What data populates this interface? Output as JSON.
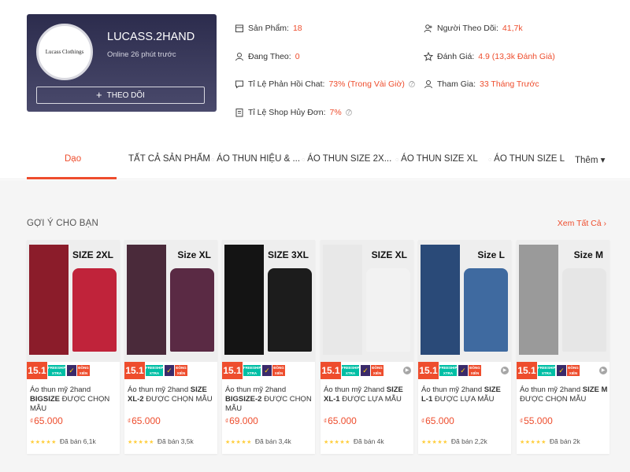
{
  "shop": {
    "avatar_text": "Lucass Clothings",
    "name": "LUCASS.2HAND",
    "online": "Online 26 phút trước",
    "follow_label": "THEO DÕI"
  },
  "stats": {
    "products_label": "Sản Phẩm:",
    "products_value": "18",
    "following_label": "Đang Theo:",
    "following_value": "0",
    "chat_label": "Tỉ Lệ Phản Hồi Chat:",
    "chat_value": "73% (Trong Vài Giờ)",
    "cancel_label": "Tỉ Lệ Shop Hủy Đơn:",
    "cancel_value": "7%",
    "followers_label": "Người Theo Dõi:",
    "followers_value": "41,7k",
    "rating_label": "Đánh Giá:",
    "rating_value": "4.9 (13,3k Đánh Giá)",
    "joined_label": "Tham Gia:",
    "joined_value": "33 Tháng Trước"
  },
  "tabs": [
    "Dạo",
    "TẤT CẢ SẢN PHẨM",
    "ÁO THUN HIỆU & ...",
    "ÁO THUN SIZE 2X...",
    "ÁO THUN SIZE XL",
    "ÁO THUN SIZE L",
    "Thêm ▾"
  ],
  "section": {
    "title": "GỢI Ý CHO BẠN",
    "see_all": "Xem Tất Cả ›"
  },
  "promo": {
    "badge": "15.1",
    "freeship": "FREESHIP XTRA",
    "dong": "ĐỒNG XIÊN"
  },
  "products": [
    {
      "size": "SIZE 2XL",
      "title_pre": "Áo thun mỹ 2hand ",
      "title_bold": "BIGSIZE",
      "title_post": " ĐƯỢC CHỌN MẪU",
      "price": "65.000",
      "sold": "Đã bán 6,1k",
      "left_color": "#8b1c2a",
      "right_color": "#c0233a"
    },
    {
      "size": "Size XL",
      "title_pre": "Áo thun mỹ 2hand ",
      "title_bold": "SIZE XL-2",
      "title_post": " ĐƯỢC CHỌN MẪU",
      "price": "65.000",
      "sold": "Đã bán 3,5k",
      "left_color": "#4a2a3a",
      "right_color": "#5a2a44"
    },
    {
      "size": "SIZE 3XL",
      "title_pre": "Áo thun mỹ 2hand ",
      "title_bold": "BIGSIZE-2",
      "title_post": " ĐƯỢC CHỌN MẪU",
      "price": "69.000",
      "sold": "Đã bán 3,4k",
      "left_color": "#141414",
      "right_color": "#1c1c1c"
    },
    {
      "size": "SIZE XL",
      "title_pre": "Áo thun mỹ 2hand ",
      "title_bold": "SIZE XL-1",
      "title_post": " ĐƯỢC LỰA MẪU",
      "price": "65.000",
      "sold": "Đã bán 4k",
      "left_color": "#e8e8e8",
      "right_color": "#f2f2f2"
    },
    {
      "size": "Size L",
      "title_pre": "Áo thun mỹ 2hand ",
      "title_bold": "SIZE L-1",
      "title_post": " ĐƯỢC LỰA MẪU",
      "price": "65.000",
      "sold": "Đã bán 2,2k",
      "left_color": "#2a4a78",
      "right_color": "#3f6aa0"
    },
    {
      "size": "Size M",
      "title_pre": "Áo thun mỹ 2hand ",
      "title_bold": "SIZE M",
      "title_post": " ĐƯỢC CHỌN MẪU",
      "price": "55.000",
      "sold": "Đã bán 2k",
      "left_color": "#9a9a9a",
      "right_color": "#e6e6e6"
    }
  ],
  "currency": "₫",
  "colors": {
    "accent": "#ee4d2d",
    "shop_card": "#2c2c4d",
    "page_bg": "#f5f5f5"
  }
}
